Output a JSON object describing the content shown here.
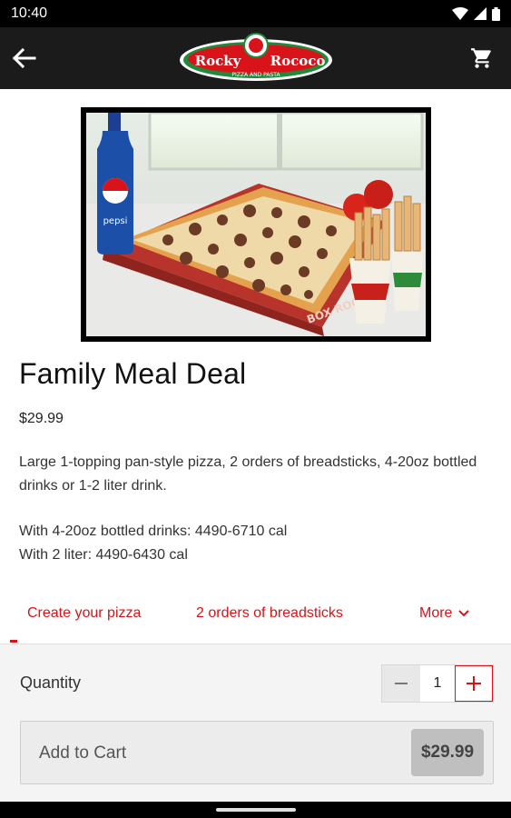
{
  "status_bar": {
    "time": "10:40"
  },
  "app_bar": {
    "logo_text_left": "Rocky",
    "logo_text_right": "Rococo",
    "logo_tagline": "PIZZA AND PASTA",
    "back_icon": "arrow-left-icon",
    "cart_icon": "shopping-cart-icon"
  },
  "product": {
    "title": "Family Meal Deal",
    "price": "$29.99",
    "description": "Large 1-topping pan-style pizza, 2 orders of breadsticks, 4-20oz bottled drinks or 1-2 liter drink.",
    "calories_bottled": "With 4-20oz bottled drinks: 4490-6710 cal",
    "calories_liter": "With 2 liter: 4490-6430 cal",
    "image": {
      "bottle_label": "pepsi",
      "box_text": "BOX ROCOCO"
    }
  },
  "tabs": [
    {
      "label": "Create your pizza"
    },
    {
      "label": "2 orders of breadsticks"
    },
    {
      "label": "More"
    }
  ],
  "quantity": {
    "label": "Quantity",
    "value": "1"
  },
  "add_to_cart": {
    "label": "Add to Cart",
    "price": "$29.99"
  },
  "colors": {
    "accent": "#d8141a",
    "app_bar": "#1b1b1b",
    "panel": "#f4f4f4"
  }
}
